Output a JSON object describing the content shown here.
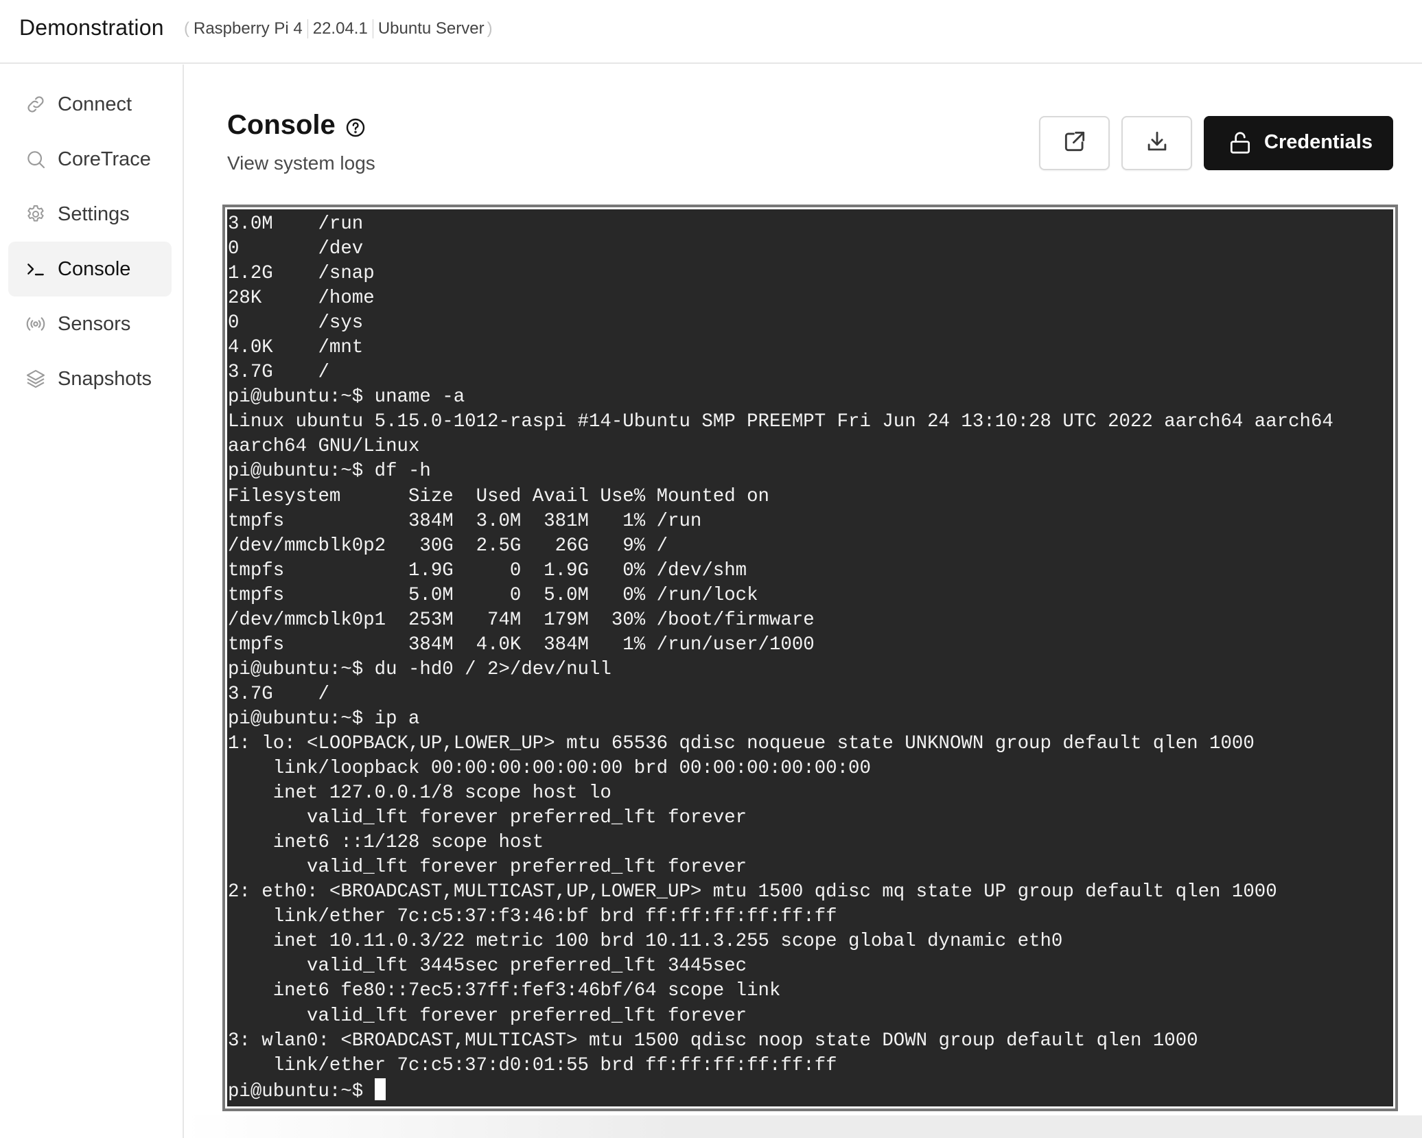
{
  "header": {
    "app_title": "Demonstration",
    "device": [
      "Raspberry Pi 4",
      "22.04.1",
      "Ubuntu Server"
    ]
  },
  "sidebar": {
    "items": [
      {
        "label": "Connect",
        "icon": "link-icon",
        "active": false
      },
      {
        "label": "CoreTrace",
        "icon": "search-icon",
        "active": false
      },
      {
        "label": "Settings",
        "icon": "gear-icon",
        "active": false
      },
      {
        "label": "Console",
        "icon": "terminal-icon",
        "active": true
      },
      {
        "label": "Sensors",
        "icon": "broadcast-icon",
        "active": false
      },
      {
        "label": "Snapshots",
        "icon": "layers-icon",
        "active": false
      }
    ]
  },
  "main": {
    "title": "Console",
    "subtitle": "View system logs",
    "actions": {
      "open_external": "external-link-icon",
      "download": "download-icon",
      "credentials_label": "Credentials"
    }
  },
  "terminal": {
    "lines": [
      "3.0M    /run",
      "0       /dev",
      "1.2G    /snap",
      "28K     /home",
      "0       /sys",
      "4.0K    /mnt",
      "3.7G    /",
      "pi@ubuntu:~$ uname -a",
      "Linux ubuntu 5.15.0-1012-raspi #14-Ubuntu SMP PREEMPT Fri Jun 24 13:10:28 UTC 2022 aarch64 aarch64",
      "aarch64 GNU/Linux",
      "pi@ubuntu:~$ df -h",
      "Filesystem      Size  Used Avail Use% Mounted on",
      "tmpfs           384M  3.0M  381M   1% /run",
      "/dev/mmcblk0p2   30G  2.5G   26G   9% /",
      "tmpfs           1.9G     0  1.9G   0% /dev/shm",
      "tmpfs           5.0M     0  5.0M   0% /run/lock",
      "/dev/mmcblk0p1  253M   74M  179M  30% /boot/firmware",
      "tmpfs           384M  4.0K  384M   1% /run/user/1000",
      "pi@ubuntu:~$ du -hd0 / 2>/dev/null",
      "3.7G    /",
      "pi@ubuntu:~$ ip a",
      "1: lo: <LOOPBACK,UP,LOWER_UP> mtu 65536 qdisc noqueue state UNKNOWN group default qlen 1000",
      "    link/loopback 00:00:00:00:00:00 brd 00:00:00:00:00:00",
      "    inet 127.0.0.1/8 scope host lo",
      "       valid_lft forever preferred_lft forever",
      "    inet6 ::1/128 scope host",
      "       valid_lft forever preferred_lft forever",
      "2: eth0: <BROADCAST,MULTICAST,UP,LOWER_UP> mtu 1500 qdisc mq state UP group default qlen 1000",
      "    link/ether 7c:c5:37:f3:46:bf brd ff:ff:ff:ff:ff:ff",
      "    inet 10.11.0.3/22 metric 100 brd 10.11.3.255 scope global dynamic eth0",
      "       valid_lft 3445sec preferred_lft 3445sec",
      "    inet6 fe80::7ec5:37ff:fef3:46bf/64 scope link",
      "       valid_lft forever preferred_lft forever",
      "3: wlan0: <BROADCAST,MULTICAST> mtu 1500 qdisc noop state DOWN group default qlen 1000",
      "    link/ether 7c:c5:37:d0:01:55 brd ff:ff:ff:ff:ff:ff"
    ],
    "prompt": "pi@ubuntu:~$ "
  },
  "colors": {
    "terminal_bg": "#282828",
    "terminal_fg": "#f2f2f2",
    "primary_button": "#141414",
    "active_nav_bg": "#f3f3f3"
  }
}
